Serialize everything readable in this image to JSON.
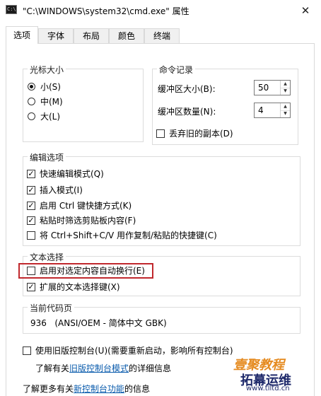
{
  "window": {
    "title": "\"C:\\WINDOWS\\system32\\cmd.exe\" 属性",
    "app_icon_text": "C:\\",
    "close_label": "✕"
  },
  "tabs": [
    {
      "label": "选项",
      "active": true
    },
    {
      "label": "字体",
      "active": false
    },
    {
      "label": "布局",
      "active": false
    },
    {
      "label": "颜色",
      "active": false
    },
    {
      "label": "终端",
      "active": false
    }
  ],
  "cursor_size": {
    "legend": "光标大小",
    "options": [
      {
        "label": "小(S)",
        "checked": true
      },
      {
        "label": "中(M)",
        "checked": false
      },
      {
        "label": "大(L)",
        "checked": false
      }
    ]
  },
  "command_history": {
    "legend": "命令记录",
    "buffer_size_label": "缓冲区大小(B):",
    "buffer_size_value": "50",
    "buffer_count_label": "缓冲区数量(N):",
    "buffer_count_value": "4",
    "discard_old_label": "丢弃旧的副本(D)",
    "discard_old_checked": false
  },
  "edit_options": {
    "legend": "编辑选项",
    "items": [
      {
        "label": "快速编辑模式(Q)",
        "checked": true
      },
      {
        "label": "插入模式(I)",
        "checked": true
      },
      {
        "label": "启用 Ctrl 键快捷方式(K)",
        "checked": true
      },
      {
        "label": "粘贴时筛选剪贴板内容(F)",
        "checked": true
      },
      {
        "label": "将 Ctrl+Shift+C/V 用作复制/粘贴的快捷键(C)",
        "checked": false
      }
    ]
  },
  "text_selection": {
    "legend": "文本选择",
    "items": [
      {
        "label": "启用对选定内容自动换行(E)",
        "checked": false
      },
      {
        "label": "扩展的文本选择键(X)",
        "checked": true
      }
    ]
  },
  "codepage": {
    "legend": "当前代码页",
    "value": "936   (ANSI/OEM - 简体中文 GBK)"
  },
  "legacy": {
    "checkbox_label": "使用旧版控制台(U)(需要重新启动，影响所有控制台)",
    "checked": false,
    "info_prefix": "了解有关",
    "info_link": "旧版控制台模式",
    "info_suffix": "的详细信息"
  },
  "more": {
    "prefix": "了解更多有关",
    "link": "新控制台功能",
    "suffix": "的信息"
  },
  "watermark": {
    "line1": "壹聚教程",
    "line2": "拓幕运维",
    "line3": "www.tlltd.cn"
  },
  "icons": {
    "check": "✓",
    "spin_up": "▲",
    "spin_down": "▼"
  }
}
